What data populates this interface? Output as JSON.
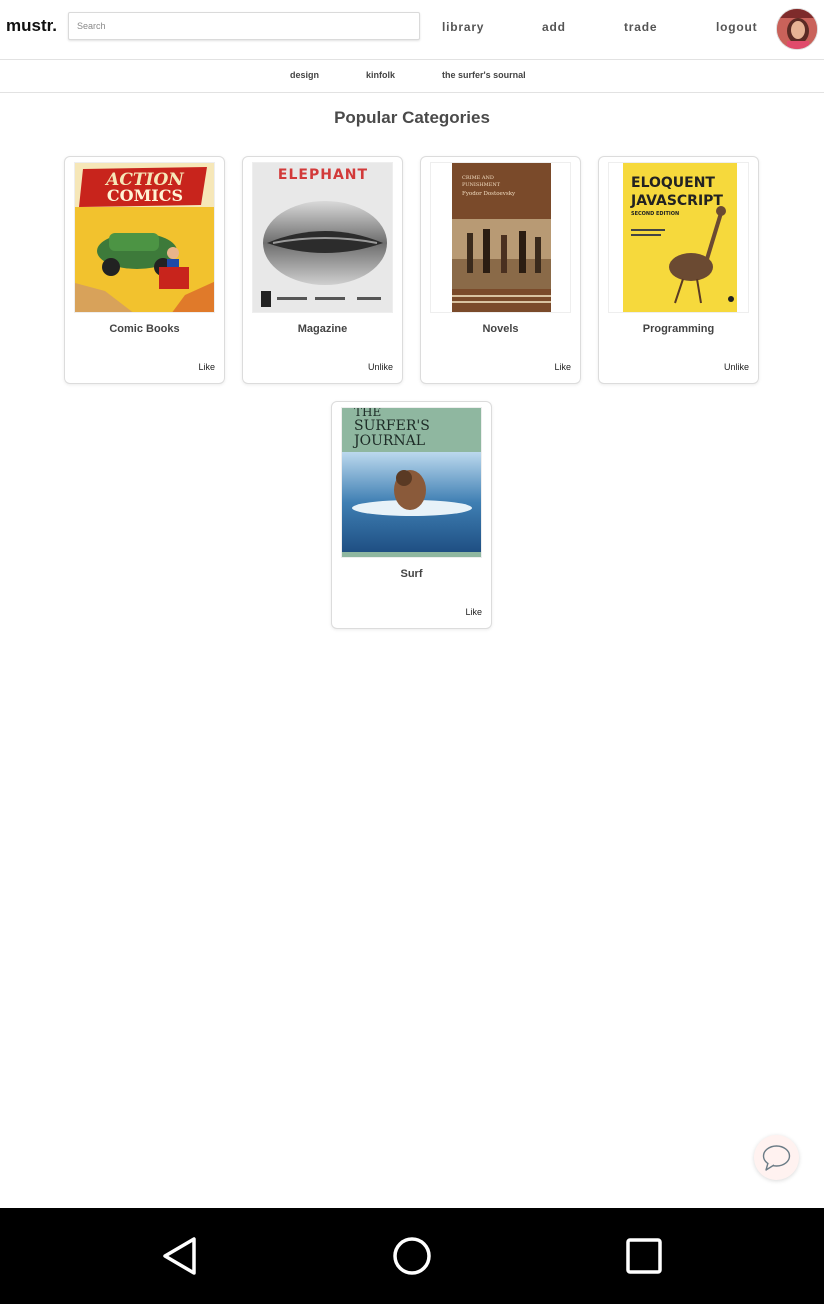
{
  "header": {
    "logo": "mustr.",
    "search_placeholder": "Search",
    "nav": [
      "library",
      "add",
      "trade",
      "logout"
    ]
  },
  "subnav": [
    "design",
    "kinfolk",
    "the surfer's sournal"
  ],
  "main": {
    "title": "Popular Categories",
    "cards": [
      {
        "title": "Comic Books",
        "action": "Like",
        "cover_text": [
          "ACTION",
          "COMICS"
        ]
      },
      {
        "title": "Magazine",
        "action": "Unlike",
        "cover_text": [
          "ELEPHANT"
        ]
      },
      {
        "title": "Novels",
        "action": "Like",
        "cover_text": [
          "CRIME AND",
          "PUNISHMENT",
          "Fyodor Dostoevsky"
        ]
      },
      {
        "title": "Programming",
        "action": "Unlike",
        "cover_text": [
          "ELOQUENT",
          "JAVASCRIPT",
          "SECOND EDITION"
        ]
      },
      {
        "title": "Surf",
        "action": "Like",
        "cover_text": [
          "THE",
          "SURFER'S",
          "JOURNAL"
        ]
      }
    ]
  },
  "icons": {
    "chat": "chat-bubble-icon",
    "back": "back-triangle-icon",
    "home": "home-circle-icon",
    "recents": "recents-square-icon"
  },
  "colors": {
    "comic_red": "#c8241c",
    "comic_yellow": "#f2c22e",
    "js_yellow": "#f6d93c",
    "novel_brown": "#7a4a2a",
    "surf_green": "#8fb7a0",
    "surf_water": "#3f7fb3"
  }
}
